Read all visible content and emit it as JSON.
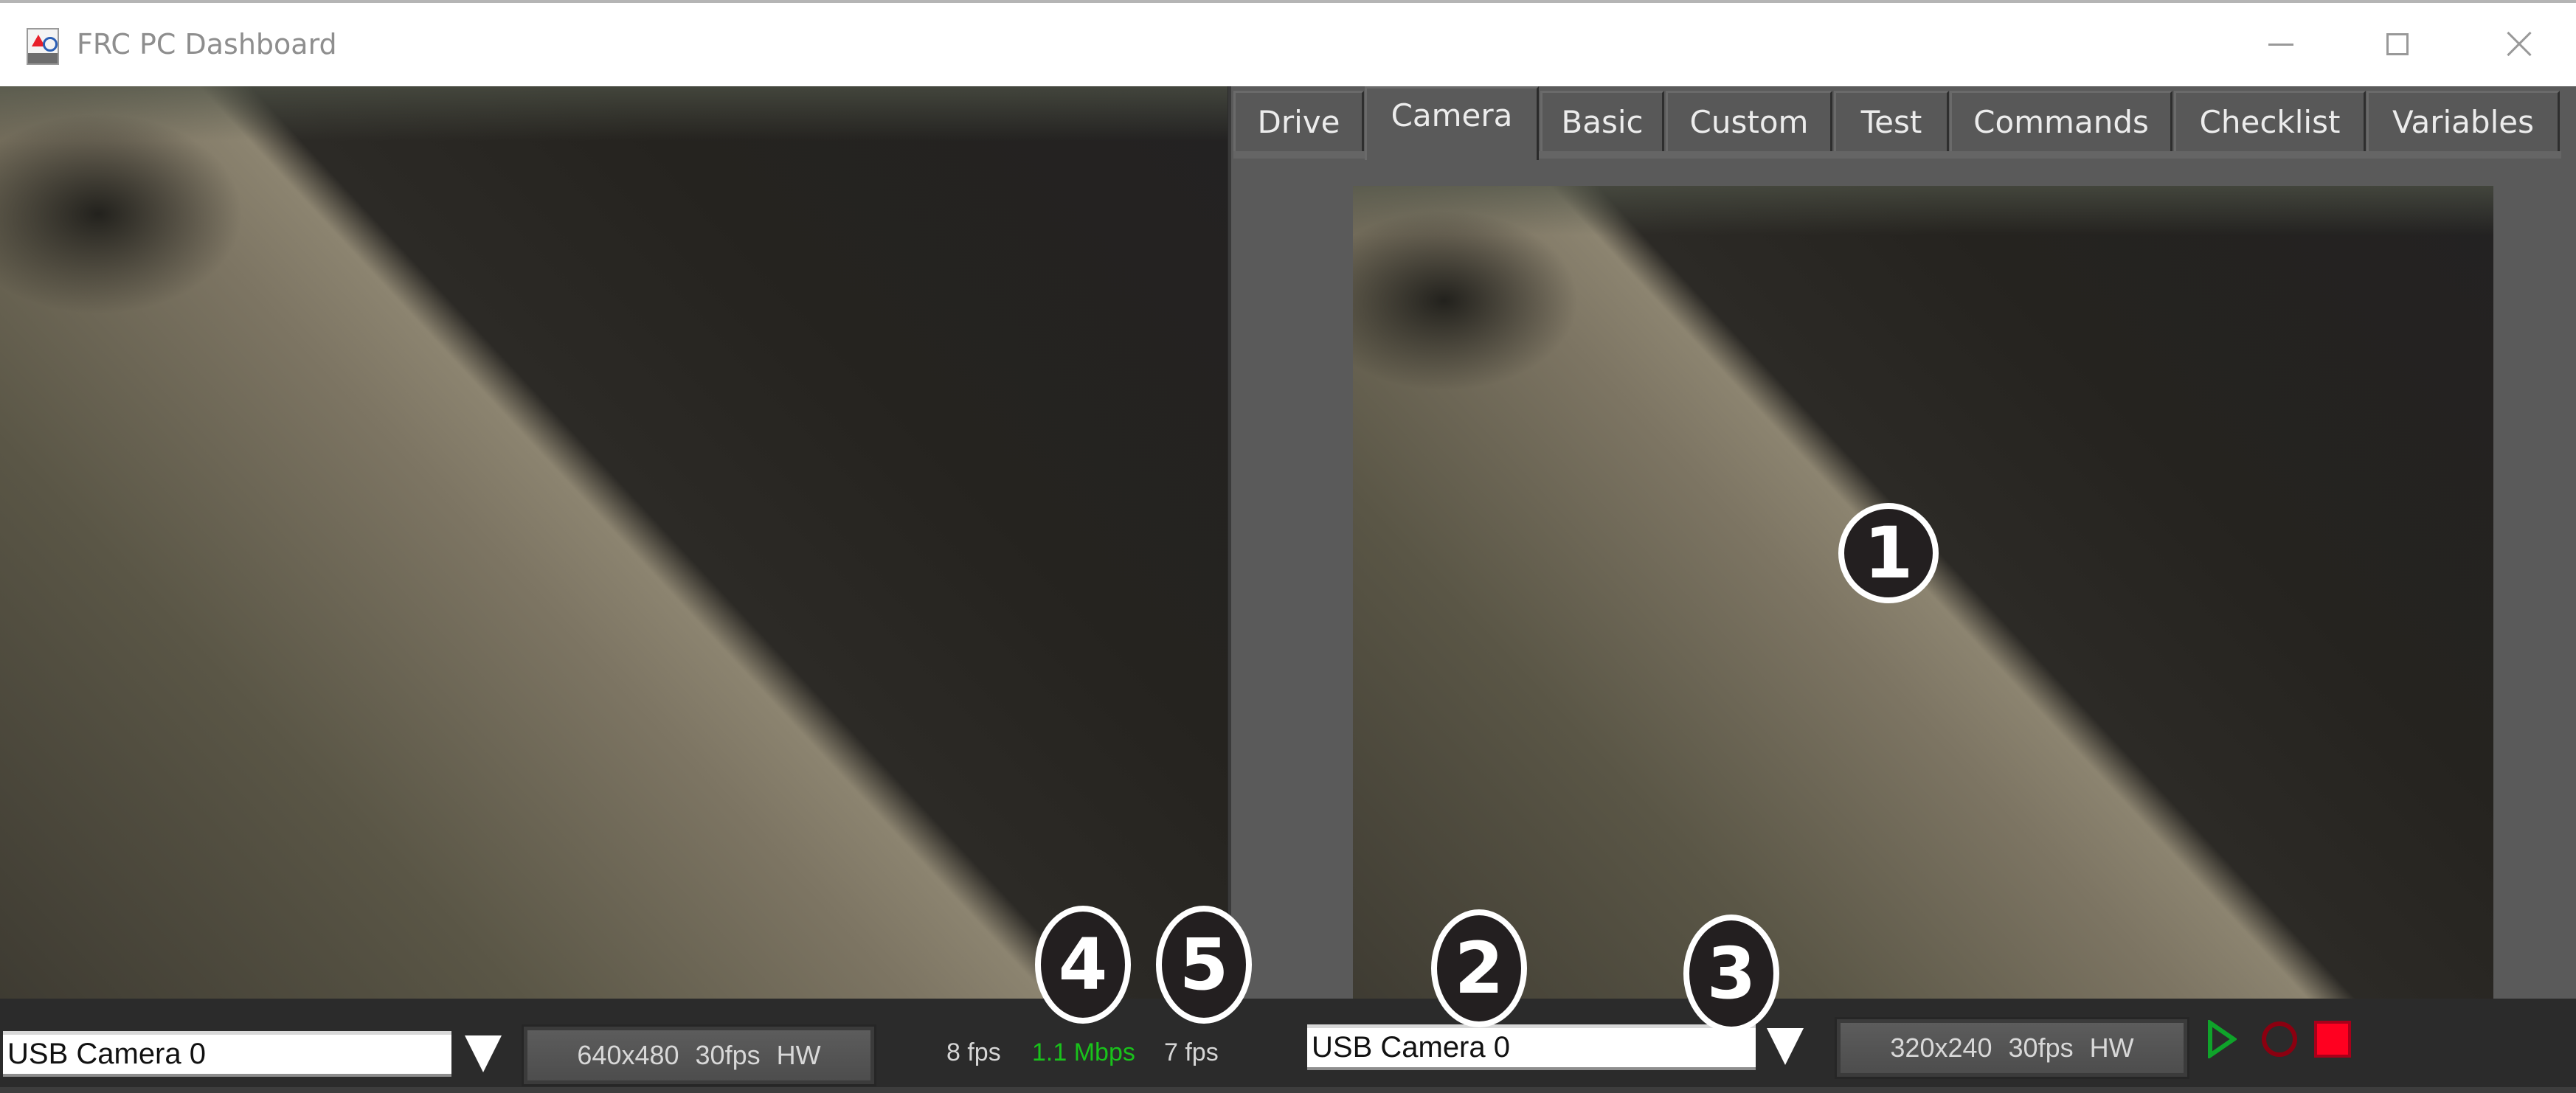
{
  "window": {
    "title": "FRC PC Dashboard",
    "icon": "frc-logo-icon",
    "controls": {
      "minimize": "minimize-icon",
      "maximize": "maximize-icon",
      "close": "close-icon"
    }
  },
  "tabs": [
    {
      "label": "Drive",
      "selected": false
    },
    {
      "label": "Camera",
      "selected": true
    },
    {
      "label": "Basic",
      "selected": false
    },
    {
      "label": "Custom",
      "selected": false
    },
    {
      "label": "Test",
      "selected": false
    },
    {
      "label": "Commands",
      "selected": false
    },
    {
      "label": "Checklist",
      "selected": false
    },
    {
      "label": "Variables",
      "selected": false
    }
  ],
  "left_camera": {
    "source_value": "USB Camera 0",
    "mode_button_label": "640x480  30fps  HW"
  },
  "stats": {
    "left_fps": "8 fps",
    "bandwidth": "1.1 Mbps",
    "right_fps": "7 fps",
    "bandwidth_color": "#19c21b"
  },
  "right_camera": {
    "source_value": "USB Camera 0",
    "mode_button_label": "320x240  30fps  HW"
  },
  "playback": {
    "play": {
      "icon": "play-icon",
      "color": "#0fa32a"
    },
    "record": {
      "icon": "record-icon",
      "color": "#8b0010"
    },
    "stop": {
      "icon": "stop-icon",
      "color": "#ff0020"
    }
  },
  "callouts": [
    "1",
    "2",
    "3",
    "4",
    "5"
  ]
}
